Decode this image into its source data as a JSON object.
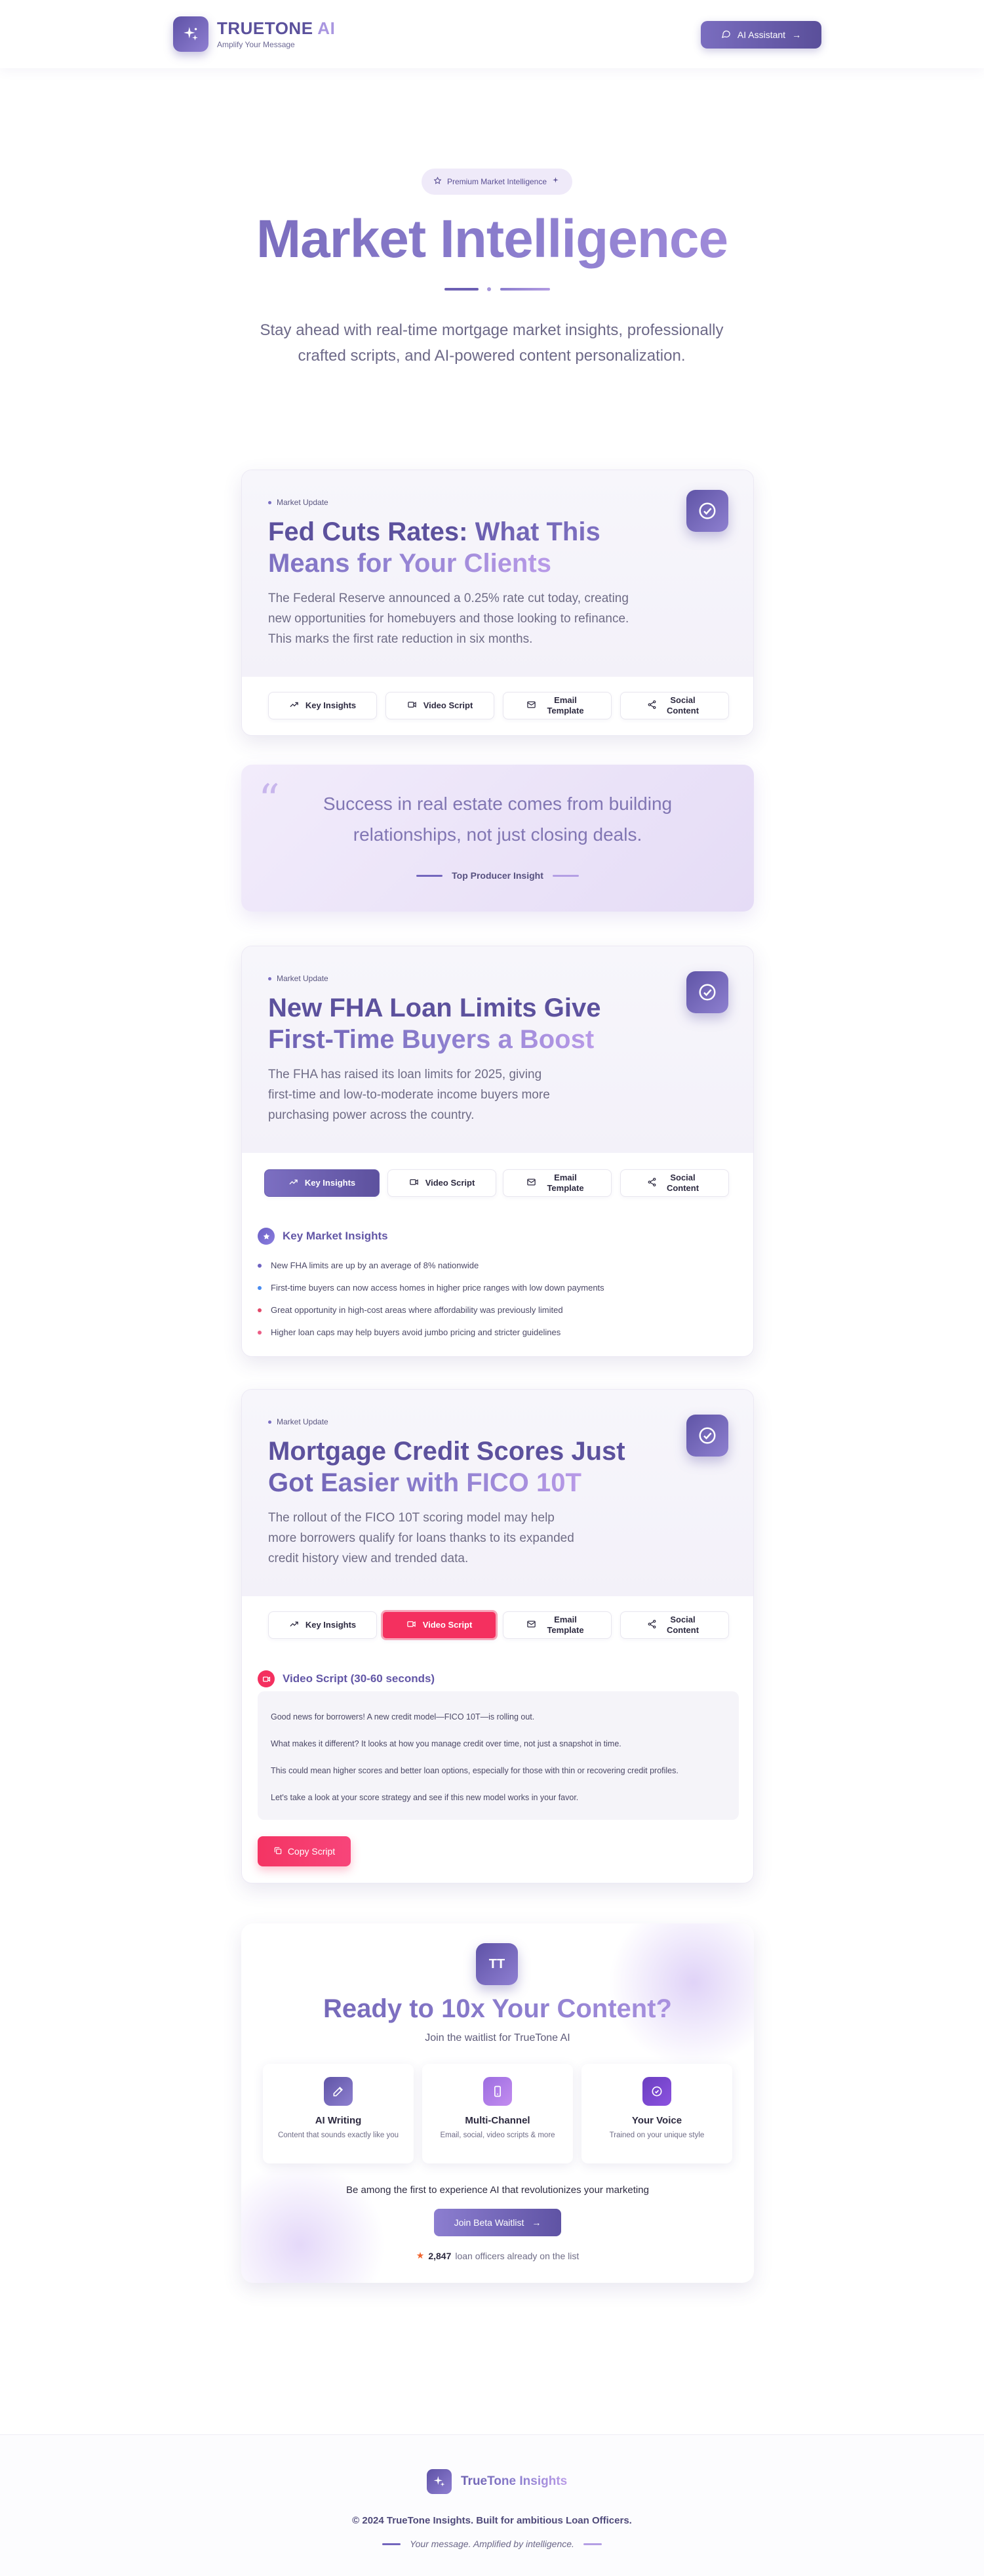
{
  "header": {
    "brand_part1": "TRUETONE",
    "brand_part2": "AI",
    "tagline": "Amplify Your Message",
    "assistant_button": "AI Assistant"
  },
  "hero": {
    "badge": "Premium Market Intelligence",
    "title": "Market Intelligence",
    "subtitle": "Stay ahead with real-time mortgage market insights, professionally crafted scripts, and AI-powered content personalization."
  },
  "tabs": {
    "key_insights": "Key Insights",
    "video_script": "Video Script",
    "email_template": "Email Template",
    "social_content": "Social Content"
  },
  "cards": [
    {
      "tag": "Market Update",
      "title_a": "Fed Cuts Rates:",
      "title_b": "What This Means for Your Clients",
      "description": "The Federal Reserve announced a 0.25% rate cut today, creating new opportunities for homebuyers and those looking to refinance. This marks the first rate reduction in six months."
    },
    {
      "tag": "Market Update",
      "title_a": "New FHA Loan Limits Give",
      "title_b": "First-Time Buyers a Boost",
      "description": "The FHA has raised its loan limits for 2025, giving first-time and low-to-moderate income buyers more purchasing power across the country.",
      "insights_heading": "Key Market Insights",
      "insights": [
        "New FHA limits are up by an average of 8% nationwide",
        "First-time buyers can now access homes in higher price ranges with low down payments",
        "Great opportunity in high-cost areas where affordability was previously limited",
        "Higher loan caps may help buyers avoid jumbo pricing and stricter guidelines"
      ]
    },
    {
      "tag": "Market Update",
      "title_a": "Mortgage Credit Scores Just",
      "title_b": "Got Easier with FICO 10T",
      "description": "The rollout of the FICO 10T scoring model may help more borrowers qualify for loans thanks to its expanded credit history view and trended data.",
      "script_heading": "Video Script (30-60 seconds)",
      "script_lines": [
        "Good news for borrowers! A new credit model—FICO 10T—is rolling out.",
        "What makes it different? It looks at how you manage credit over time, not just a snapshot in time.",
        "This could mean higher scores and better loan options, especially for those with thin or recovering credit profiles.",
        "Let's take a look at your score strategy and see if this new model works in your favor."
      ],
      "copy_button": "Copy Script"
    }
  ],
  "quote": {
    "text": "Success in real estate comes from building relationships, not just closing deals.",
    "attribution": "Top Producer Insight"
  },
  "cta": {
    "badge": "TT",
    "title": "Ready to 10x Your Content?",
    "subtitle": "Join the waitlist for TrueTone AI",
    "features": [
      {
        "title": "AI Writing",
        "desc": "Content that sounds exactly like you"
      },
      {
        "title": "Multi-Channel",
        "desc": "Email, social, video scripts & more"
      },
      {
        "title": "Your Voice",
        "desc": "Trained on your unique style"
      }
    ],
    "line": "Be among the first to experience AI that revolutionizes your marketing",
    "button": "Join Beta Waitlist",
    "count": "2,847",
    "count_suffix": "loan officers already on the list"
  },
  "footer": {
    "brand": "TrueTone Insights",
    "copyright": "© 2024 TrueTone Insights. Built for ambitious Loan Officers.",
    "tagline": "Your message. Amplified by intelligence."
  },
  "colors": {
    "brand_purple": "#6b5fb0",
    "accent_pink": "#f4305f",
    "light_lavender": "#efeaf9"
  }
}
